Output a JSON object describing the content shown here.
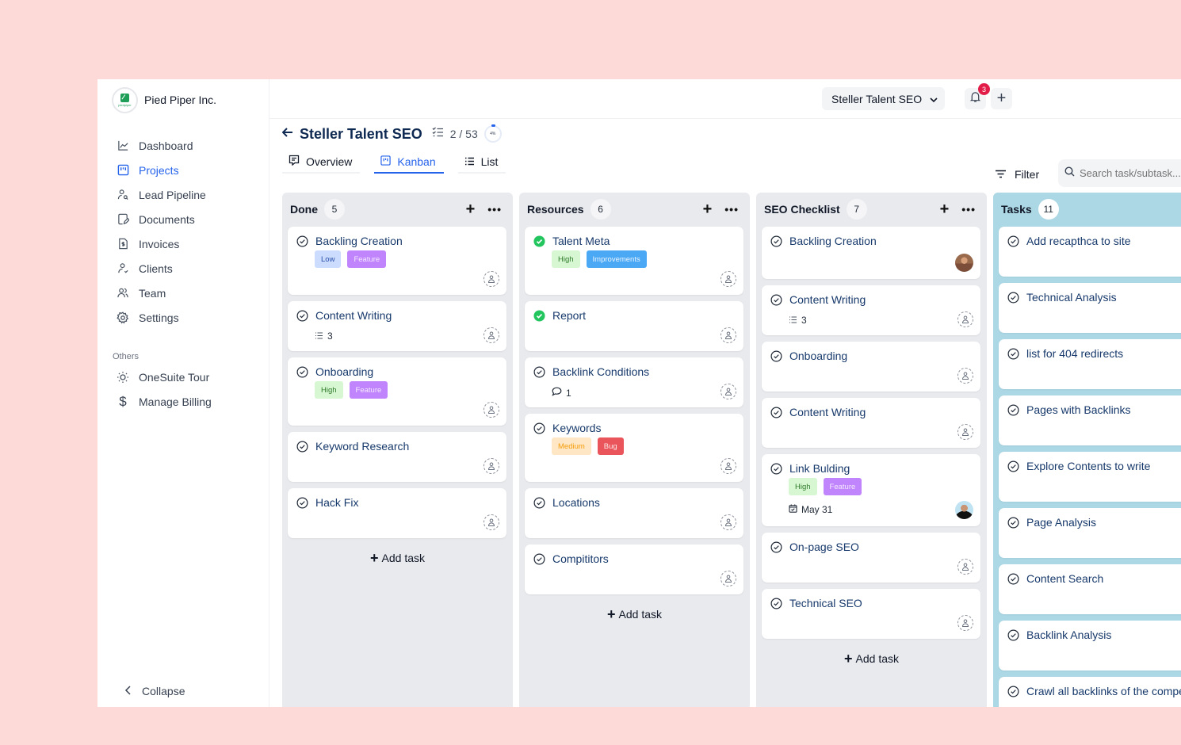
{
  "sidebar": {
    "company": "Pied Piper Inc.",
    "logo_text": "piedpiper",
    "items": [
      {
        "label": "Dashboard",
        "icon": "chart-line-icon",
        "active": false
      },
      {
        "label": "Projects",
        "icon": "kanban-icon",
        "active": true
      },
      {
        "label": "Lead Pipeline",
        "icon": "user-search-icon",
        "active": false
      },
      {
        "label": "Documents",
        "icon": "document-edit-icon",
        "active": false
      },
      {
        "label": "Invoices",
        "icon": "invoice-icon",
        "active": false
      },
      {
        "label": "Clients",
        "icon": "user-check-icon",
        "active": false
      },
      {
        "label": "Team",
        "icon": "team-icon",
        "active": false
      },
      {
        "label": "Settings",
        "icon": "gear-icon",
        "active": false
      }
    ],
    "others_label": "Others",
    "others": [
      {
        "label": "OneSuite Tour",
        "icon": "sun-icon"
      },
      {
        "label": "Manage Billing",
        "icon": "dollar-icon"
      }
    ],
    "collapse_label": "Collapse"
  },
  "topbar": {
    "project_select": "Steller Talent SEO",
    "notification_count": "3"
  },
  "header": {
    "title": "Steller Talent SEO",
    "task_progress": "2 / 53",
    "progress_percent": "4%",
    "tabs": [
      {
        "label": "Overview",
        "icon": "comment-square-icon",
        "active": false
      },
      {
        "label": "Kanban",
        "icon": "kanban-icon",
        "active": true
      },
      {
        "label": "List",
        "icon": "list-icon",
        "active": false
      }
    ],
    "filter_label": "Filter",
    "search_placeholder": "Search task/subtask..."
  },
  "columns": [
    {
      "title": "Done",
      "count": "5",
      "add_label": "Add task",
      "cards": [
        {
          "title": "Backling Creation",
          "status": "open",
          "tags": [
            {
              "label": "Low",
              "kind": "low"
            },
            {
              "label": "Feature",
              "kind": "feature"
            }
          ]
        },
        {
          "title": "Content Writing",
          "status": "open",
          "subtasks": "3"
        },
        {
          "title": "Onboarding",
          "status": "open",
          "tags": [
            {
              "label": "High",
              "kind": "high"
            },
            {
              "label": "Feature",
              "kind": "feature"
            }
          ]
        },
        {
          "title": "Keyword Research",
          "status": "open"
        },
        {
          "title": "Hack Fix",
          "status": "open"
        }
      ]
    },
    {
      "title": "Resources",
      "count": "6",
      "add_label": "Add task",
      "cards": [
        {
          "title": "Talent Meta",
          "status": "done",
          "tags": [
            {
              "label": "High",
              "kind": "high"
            },
            {
              "label": "Improvements",
              "kind": "improve"
            }
          ]
        },
        {
          "title": "Report",
          "status": "done"
        },
        {
          "title": "Backlink Conditions",
          "status": "open",
          "comments": "1"
        },
        {
          "title": "Keywords",
          "status": "open",
          "tags": [
            {
              "label": "Medium",
              "kind": "medium"
            },
            {
              "label": "Bug",
              "kind": "bug"
            }
          ]
        },
        {
          "title": "Locations",
          "status": "open"
        },
        {
          "title": "Compititors",
          "status": "open"
        }
      ]
    },
    {
      "title": "SEO Checklist",
      "count": "7",
      "add_label": "Add task",
      "cards": [
        {
          "title": "Backling Creation",
          "status": "open",
          "avatar": "avatar-1"
        },
        {
          "title": "Content Writing",
          "status": "open",
          "subtasks": "3"
        },
        {
          "title": "Onboarding",
          "status": "open"
        },
        {
          "title": "Content Writing",
          "status": "open"
        },
        {
          "title": "Link Bulding",
          "status": "open",
          "tags": [
            {
              "label": "High",
              "kind": "high"
            },
            {
              "label": "Feature",
              "kind": "feature"
            }
          ],
          "due": "May 31",
          "avatar": "avatar-2"
        },
        {
          "title": "On-page SEO",
          "status": "open"
        },
        {
          "title": "Technical SEO",
          "status": "open"
        }
      ]
    },
    {
      "title": "Tasks",
      "count": "11",
      "cards": [
        {
          "title": "Add recapthca to site",
          "status": "open"
        },
        {
          "title": "Technical Analysis",
          "status": "open"
        },
        {
          "title": "list for 404 redirects",
          "status": "open"
        },
        {
          "title": "Pages with Backlinks",
          "status": "open"
        },
        {
          "title": "Explore Contents to write",
          "status": "open"
        },
        {
          "title": "Page Analysis",
          "status": "open"
        },
        {
          "title": "Content Search",
          "status": "open"
        },
        {
          "title": "Backlink Analysis",
          "status": "open"
        },
        {
          "title": "Crawl all backlinks of the competitors",
          "status": "open"
        }
      ]
    }
  ]
}
